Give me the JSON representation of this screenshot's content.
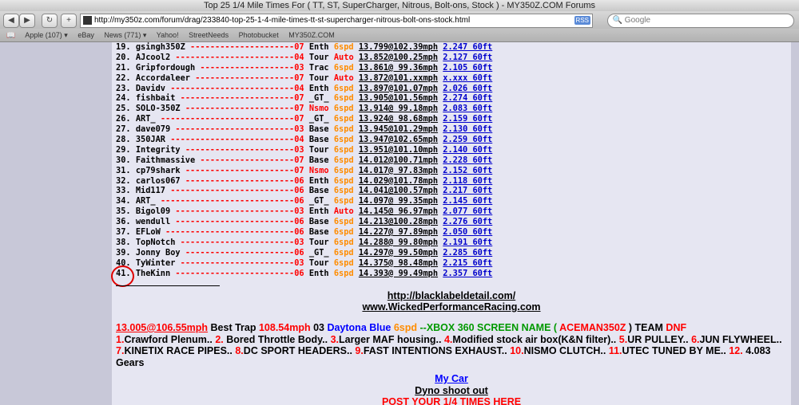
{
  "browser": {
    "title": "Top 25 1/4 Mile Times For ( TT, ST, SuperCharger, Nitrous, Bolt-ons, Stock ) - MY350Z.COM Forums",
    "url": "http://my350z.com/forum/drag/233840-top-25-1-4-mile-times-tt-st-supercharger-nitrous-bolt-ons-stock.html",
    "rss": "RSS",
    "search_placeholder": "Google",
    "bookmarks": [
      "Apple (107) ▾",
      "eBay",
      "News (771) ▾",
      "Yahoo!",
      "StreetNeeds",
      "Photobucket",
      "MY350Z.COM"
    ]
  },
  "times": [
    {
      "rank": "19.",
      "name": "gsingh350Z",
      "dashes": "---------------------",
      "cls": "07",
      "trim": "Enth",
      "gear": "6spd",
      "time": "13.799@102.39mph",
      "sixty": "2.247 60ft"
    },
    {
      "rank": "20.",
      "name": "AJcool2",
      "dashes": "------------------------",
      "cls": "04",
      "trim": "Tour",
      "gear": "Auto",
      "time": "13.852@100.25mph",
      "sixty": "2.127 60ft"
    },
    {
      "rank": "21.",
      "name": "Gripfordough",
      "dashes": "-------------------",
      "cls": "03",
      "trim": "Trac",
      "gear": "6spd",
      "time": "13.861@ 99.36mph",
      "sixty": "2.105 60ft"
    },
    {
      "rank": "22.",
      "name": "Accordaleer",
      "dashes": "--------------------",
      "cls": "07",
      "trim": "Tour",
      "gear": "Auto",
      "time": "13.872@101.xxmph",
      "sixty": "x.xxx 60ft"
    },
    {
      "rank": "23.",
      "name": "Davidv",
      "dashes": "-------------------------",
      "cls": "04",
      "trim": "Enth",
      "gear": "6spd",
      "time": "13.897@101.07mph",
      "sixty": "2.026 60ft"
    },
    {
      "rank": "24.",
      "name": "fishbait",
      "dashes": "-----------------------",
      "cls": "07",
      "trim": "_GT_",
      "gear": "6spd",
      "time": "13.905@101.56mph",
      "sixty": "2.274 60ft"
    },
    {
      "rank": "25.",
      "name": "SOLO-350Z",
      "dashes": "----------------------",
      "cls": "07",
      "trim": "Nsmo",
      "gear": "6spd",
      "time": "13.914@ 99.18mph",
      "sixty": "2.083 60ft"
    },
    {
      "rank": "26.",
      "name": "ART_",
      "dashes": "---------------------------",
      "cls": "07",
      "trim": "_GT_",
      "gear": "6spd",
      "time": "13.924@ 98.68mph",
      "sixty": "2.159 60ft"
    },
    {
      "rank": "27.",
      "name": "dave079",
      "dashes": "------------------------",
      "cls": "03",
      "trim": "Base",
      "gear": "6spd",
      "time": "13.945@101.29mph",
      "sixty": "2.130 60ft"
    },
    {
      "rank": "28.",
      "name": "350JAR",
      "dashes": "-------------------------",
      "cls": "04",
      "trim": "Base",
      "gear": "6spd",
      "time": "13.947@102.65mph",
      "sixty": "2.259 60ft"
    },
    {
      "rank": "29.",
      "name": "Integrity",
      "dashes": "----------------------",
      "cls": "03",
      "trim": "Tour",
      "gear": "6spd",
      "time": "13.951@101.10mph",
      "sixty": "2.140 60ft"
    },
    {
      "rank": "30.",
      "name": "Faithmassive",
      "dashes": "-------------------",
      "cls": "07",
      "trim": "Base",
      "gear": "6spd",
      "time": "14.012@100.71mph",
      "sixty": "2.228 60ft"
    },
    {
      "rank": "31.",
      "name": "cp79shark",
      "dashes": "----------------------",
      "cls": "07",
      "trim": "Nsmo",
      "gear": "6spd",
      "time": "14.017@ 97.83mph",
      "sixty": "2.152 60ft"
    },
    {
      "rank": "32.",
      "name": "carlos067",
      "dashes": "----------------------",
      "cls": "06",
      "trim": "Enth",
      "gear": "6spd",
      "time": "14.029@101.78mph",
      "sixty": "2.118 60ft"
    },
    {
      "rank": "33.",
      "name": "Mid117",
      "dashes": "-------------------------",
      "cls": "06",
      "trim": "Base",
      "gear": "6spd",
      "time": "14.041@100.57mph",
      "sixty": "2.217 60ft"
    },
    {
      "rank": "34.",
      "name": "ART_",
      "dashes": "---------------------------",
      "cls": "06",
      "trim": "_GT_",
      "gear": "6spd",
      "time": "14.097@ 99.35mph",
      "sixty": "2.145 60ft"
    },
    {
      "rank": "35.",
      "name": "Bigol09",
      "dashes": "------------------------",
      "cls": "03",
      "trim": "Enth",
      "gear": "Auto",
      "time": "14.145@ 96.97mph",
      "sixty": "2.077 60ft"
    },
    {
      "rank": "36.",
      "name": "wendull",
      "dashes": "------------------------",
      "cls": "06",
      "trim": "Base",
      "gear": "6spd",
      "time": "14.213@100.28mph",
      "sixty": "2.276 60ft"
    },
    {
      "rank": "37.",
      "name": "EFLoW",
      "dashes": "--------------------------",
      "cls": "06",
      "trim": "Base",
      "gear": "6spd",
      "time": "14.227@ 97.89mph",
      "sixty": "2.050 60ft"
    },
    {
      "rank": "38.",
      "name": "TopNotch",
      "dashes": "-----------------------",
      "cls": "03",
      "trim": "Tour",
      "gear": "6spd",
      "time": "14.288@ 99.80mph",
      "sixty": "2.191 60ft"
    },
    {
      "rank": "39.",
      "name": "Jonny Boy",
      "dashes": "----------------------",
      "cls": "06",
      "trim": "_GT_",
      "gear": "6spd",
      "time": "14.297@ 99.50mph",
      "sixty": "2.285 60ft"
    },
    {
      "rank": "40.",
      "name": "TyWinter",
      "dashes": "-----------------------",
      "cls": "03",
      "trim": "Tour",
      "gear": "6spd",
      "time": "14.375@ 98.48mph",
      "sixty": "2.215 60ft"
    },
    {
      "rank": "41.",
      "name": "TheKinn",
      "dashes": "------------------------",
      "cls": "06",
      "trim": "Enth",
      "gear": "6spd",
      "time": "14.393@ 99.49mph",
      "sixty": "2.357 60ft"
    }
  ],
  "signature": {
    "link1": "http://blacklabeldetail.com/",
    "link2": "www.WickedPerformanceRacing.com",
    "best_time": "13.005@106.55mph",
    "best_trap_label": " Best Trap ",
    "best_trap": "108.54mph",
    "year": " 03 ",
    "color": "Daytona Blue",
    "gear": "6spd",
    "xbox_label": " --XBOX 360 SCREEN NAME ( ",
    "xbox_name": "ACEMAN350Z",
    "team_label": " ) TEAM ",
    "team": "DNF",
    "mods": [
      {
        "n": "1.",
        "t": "Crawford Plenum.. "
      },
      {
        "n": "2.",
        "t": " Bored Throttle Body.. "
      },
      {
        "n": "3.",
        "t": "Larger MAF housing.. "
      },
      {
        "n": "4.",
        "t": "Modified stock air box(K&N filter).. "
      },
      {
        "n": "5.",
        "t": "UR PULLEY.. "
      },
      {
        "n": "6.",
        "t": "JUN FLYWHEEL.. "
      },
      {
        "n": "7.",
        "t": "KINETIX RACE PIPES.. "
      },
      {
        "n": "8.",
        "t": "DC SPORT HEADERS.. "
      },
      {
        "n": "9.",
        "t": "FAST INTENTIONS EXHAUST.. "
      },
      {
        "n": "10.",
        "t": "NISMO CLUTCH.. "
      },
      {
        "n": "11.",
        "t": "UTEC TUNED BY ME.. "
      },
      {
        "n": "12.",
        "t": " 4.083 Gears"
      }
    ],
    "my_car": "My Car",
    "dyno": "Dyno shoot out",
    "post_times": "POST YOUR 1/4 TIMES HERE"
  }
}
